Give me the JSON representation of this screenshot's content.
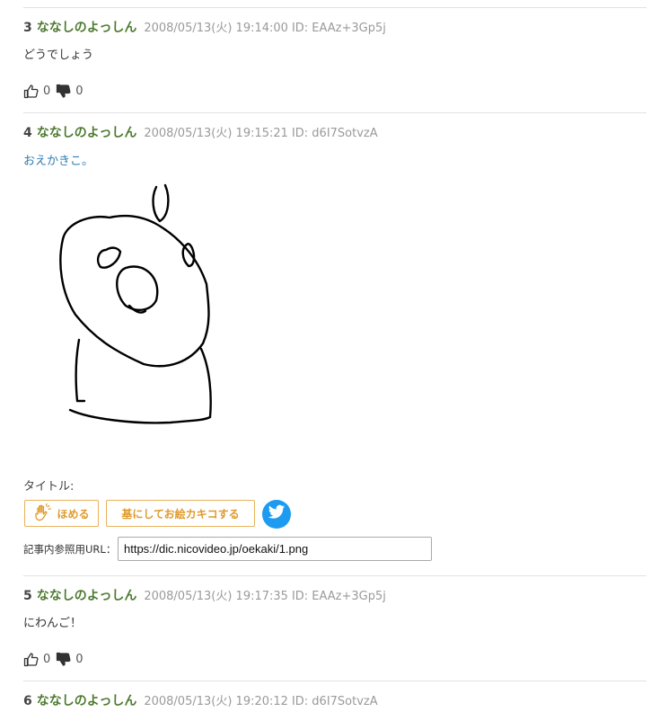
{
  "posts": [
    {
      "num": "3",
      "name": "ななしのよっしん",
      "date": "2008/05/13(火) 19:14:00",
      "id": "ID: EAAz+3Gp5j",
      "body": "どうでしょう",
      "likes": "0",
      "dislikes": "0"
    },
    {
      "num": "4",
      "name": "ななしのよっしん",
      "date": "2008/05/13(火) 19:15:21",
      "id": "ID: d6I7SotvzA",
      "body": "おえかきこ。"
    },
    {
      "num": "5",
      "name": "ななしのよっしん",
      "date": "2008/05/13(火) 19:17:35",
      "id": "ID: EAAz+3Gp5j",
      "body": "にわんご！",
      "likes": "0",
      "dislikes": "0"
    },
    {
      "num": "6",
      "name": "ななしのよっしん",
      "date": "2008/05/13(火) 19:20:12",
      "id": "ID: d6I7SotvzA"
    }
  ],
  "oekaki": {
    "title_label": "タイトル:",
    "homeru_label": "ほめる",
    "moto_label": "基にしてお絵カキコする",
    "url_label": "記事内参照用URL：",
    "url_value": "https://dic.nicovideo.jp/oekaki/1.png"
  },
  "icons": {
    "like": "thumbs-up-icon",
    "dislike": "thumbs-down-icon",
    "homeru": "clapping-hand-icon",
    "share": "twitter-bird-icon"
  },
  "colors": {
    "name": "#4d7a2f",
    "link": "#2d7bb3",
    "button_accent": "#e09a2a",
    "twitter": "#1d9bf0"
  }
}
